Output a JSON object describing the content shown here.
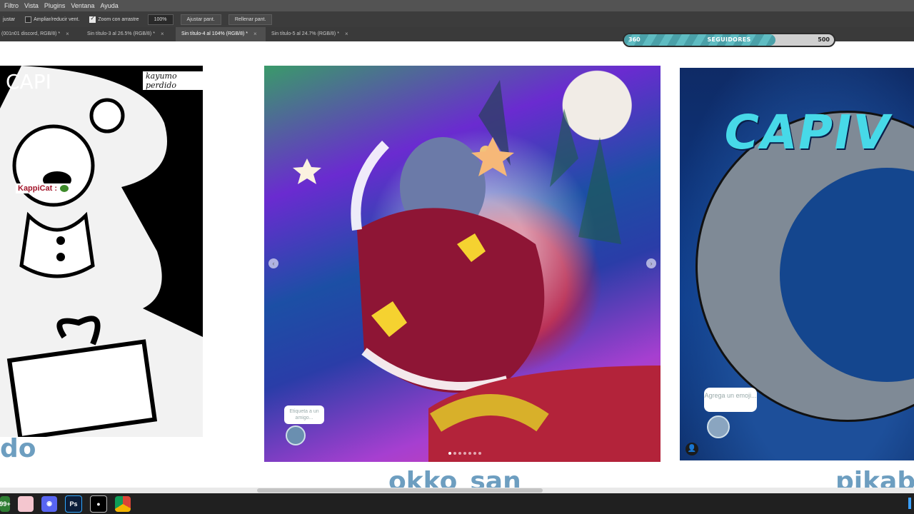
{
  "menubar": {
    "items": [
      "Filtro",
      "Vista",
      "Plugins",
      "Ventana",
      "Ayuda"
    ]
  },
  "options": {
    "partial_label": "justar",
    "resize_label": "Ampliar/reducir vent.",
    "resize_checked": false,
    "scrubby_label": "Zoom con arrastre",
    "scrubby_checked": true,
    "zoom_value": "100%",
    "fit_label": "Ajustar pant.",
    "fill_label": "Rellenar pant."
  },
  "tabs": [
    {
      "label": "(001n01 discord, RGB/8) *",
      "active": false
    },
    {
      "label": "Sin título-3 al 26.5% (RGB/8) *",
      "active": false
    },
    {
      "label": "Sin título-4 al 104% (RGB/8) *",
      "active": true
    },
    {
      "label": "Sin título-5 al 24.7% (RGB/8) *",
      "active": false
    }
  ],
  "follower_bar": {
    "current": "360",
    "label": "SEGUIDORES",
    "goal": "500",
    "progress": 0.72
  },
  "cards": {
    "left": {
      "title_fragment": "CAPI",
      "signature": "kayumo perdido",
      "chat_user": "KappiCat :",
      "username": "do"
    },
    "middle": {
      "tag_hint": "Etiqueta a un amigo...",
      "username": "okko_san"
    },
    "right": {
      "title_fragment": "CAPIV",
      "tag_hint": "Agrega un emoji...",
      "username": "pikab"
    }
  },
  "taskbar": {
    "badge": "99+",
    "apps": [
      "badge-app",
      "paint-app",
      "discord-app",
      "photoshop-app",
      "obs-app",
      "chrome-app"
    ]
  },
  "colors": {
    "username": "#6d9ec0",
    "follower_fill": "#5fbcc2",
    "ps_menu": "#535353"
  }
}
